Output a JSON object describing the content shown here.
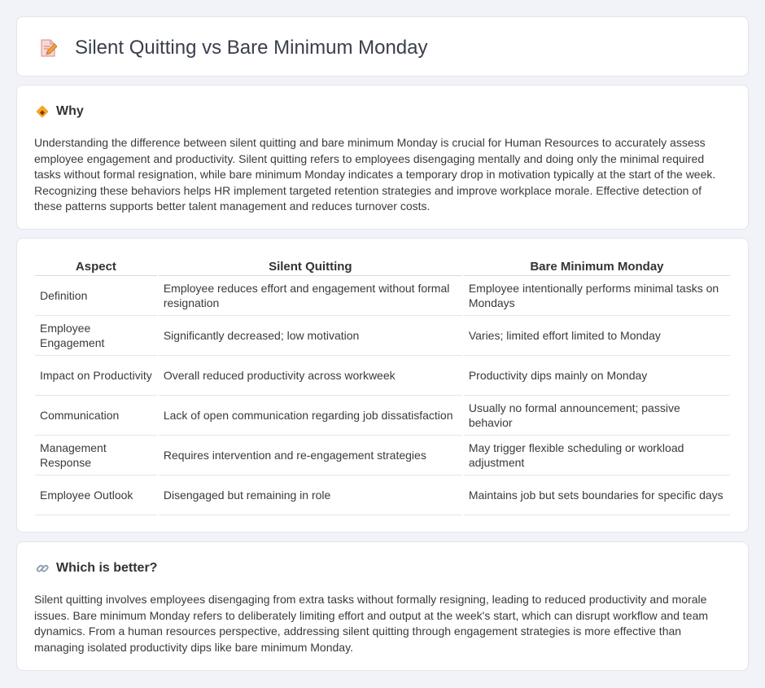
{
  "header": {
    "title": "Silent Quitting vs Bare Minimum Monday",
    "icon": "document-pencil-icon"
  },
  "why": {
    "heading": "Why",
    "icon": "diamond-warning-icon",
    "text": "Understanding the difference between silent quitting and bare minimum Monday is crucial for Human Resources to accurately assess employee engagement and productivity. Silent quitting refers to employees disengaging mentally and doing only the minimal required tasks without formal resignation, while bare minimum Monday indicates a temporary drop in motivation typically at the start of the week. Recognizing these behaviors helps HR implement targeted retention strategies and improve workplace morale. Effective detection of these patterns supports better talent management and reduces turnover costs."
  },
  "comparison": {
    "headers": [
      "Aspect",
      "Silent Quitting",
      "Bare Minimum Monday"
    ],
    "rows": [
      [
        "Definition",
        "Employee reduces effort and engagement without formal resignation",
        "Employee intentionally performs minimal tasks on Mondays"
      ],
      [
        "Employee Engagement",
        "Significantly decreased; low motivation",
        "Varies; limited effort limited to Monday"
      ],
      [
        "Impact on Productivity",
        "Overall reduced productivity across workweek",
        "Productivity dips mainly on Monday"
      ],
      [
        "Communication",
        "Lack of open communication regarding job dissatisfaction",
        "Usually no formal announcement; passive behavior"
      ],
      [
        "Management Response",
        "Requires intervention and re-engagement strategies",
        "May trigger flexible scheduling or workload adjustment"
      ],
      [
        "Employee Outlook",
        "Disengaged but remaining in role",
        "Maintains job but sets boundaries for specific days"
      ]
    ]
  },
  "better": {
    "heading": "Which is better?",
    "icon": "link-icon",
    "text": "Silent quitting involves employees disengaging from extra tasks without formally resigning, leading to reduced productivity and morale issues. Bare minimum Monday refers to deliberately limiting effort and output at the week's start, which can disrupt workflow and team dynamics. From a human resources perspective, addressing silent quitting through engagement strategies is more effective than managing isolated productivity dips like bare minimum Monday."
  }
}
